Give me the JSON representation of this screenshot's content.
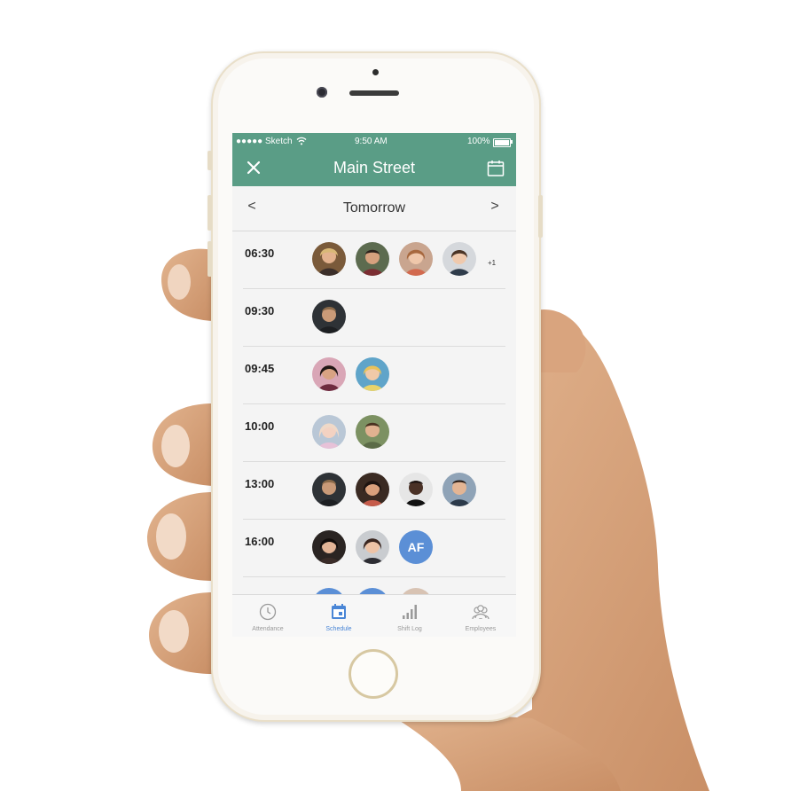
{
  "status_bar": {
    "carrier": "●●●●● Sketch",
    "time": "9:50 AM",
    "battery": "100%"
  },
  "header": {
    "title": "Main Street",
    "close_icon": "close-icon",
    "calendar_icon": "calendar-icon"
  },
  "day_nav": {
    "prev": "<",
    "title": "Tomorrow",
    "next": ">"
  },
  "slots": [
    {
      "time": "06:30",
      "avatars": 4,
      "extra": "+1"
    },
    {
      "time": "09:30",
      "avatars": 1
    },
    {
      "time": "09:45",
      "avatars": 2
    },
    {
      "time": "10:00",
      "avatars": 2
    },
    {
      "time": "13:00",
      "avatars": 4
    },
    {
      "time": "16:00",
      "avatars": 2,
      "initials": "AF"
    }
  ],
  "tabs": [
    {
      "label": "Attendance",
      "icon": "clock-icon",
      "active": false
    },
    {
      "label": "Schedule",
      "icon": "calendar-icon",
      "active": true
    },
    {
      "label": "Shift Log",
      "icon": "bar-chart-icon",
      "active": false
    },
    {
      "label": "Employees",
      "icon": "people-icon",
      "active": false
    }
  ],
  "colors": {
    "header": "#5a9d86",
    "accent": "#4a86d6",
    "avatar_initials_bg": "#5b8fd6"
  }
}
